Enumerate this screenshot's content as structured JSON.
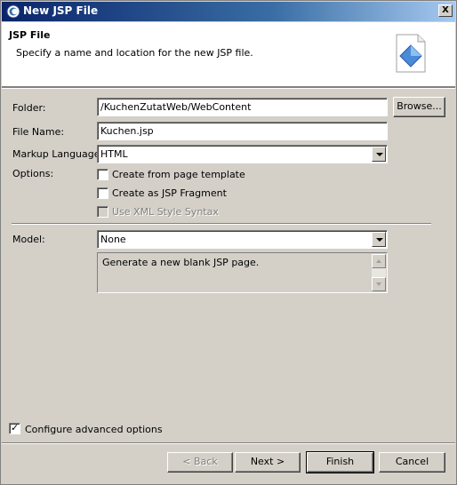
{
  "window": {
    "title": "New JSP File",
    "close_label": "X"
  },
  "banner": {
    "title": "JSP File",
    "description": "Specify a name and location for the new JSP file."
  },
  "form": {
    "folder_label": "Folder:",
    "folder_value": "/KuchenZutatWeb/WebContent",
    "browse_label": "Browse...",
    "filename_label": "File Name:",
    "filename_value": "Kuchen.jsp",
    "markup_label": "Markup Language:",
    "markup_value": "HTML",
    "options_label": "Options:",
    "options": [
      {
        "label": "Create from page template",
        "checked": false,
        "enabled": true
      },
      {
        "label": "Create as JSP Fragment",
        "checked": false,
        "enabled": true
      },
      {
        "label": "Use XML Style Syntax",
        "checked": false,
        "enabled": false
      }
    ],
    "model_label": "Model:",
    "model_value": "None",
    "model_description": "Generate a new blank JSP page."
  },
  "advanced": {
    "label": "Configure advanced options",
    "checked": true
  },
  "buttons": {
    "back": "< Back",
    "next": "Next >",
    "finish": "Finish",
    "cancel": "Cancel"
  },
  "colors": {
    "dialog_bg": "#d4d0c8",
    "title_start": "#0a246a",
    "title_end": "#a6caf0"
  }
}
